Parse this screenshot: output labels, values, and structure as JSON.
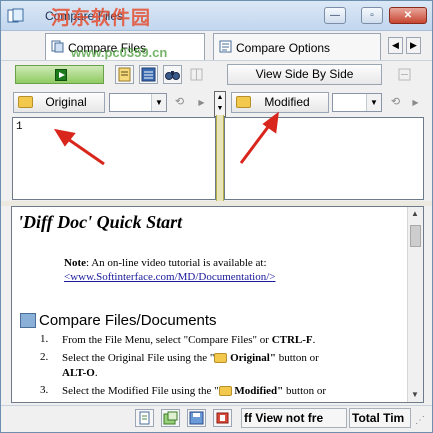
{
  "window": {
    "title": "Compare Files",
    "watermark": "河东软件园",
    "watermark_url": "www.pc0359.cn",
    "controls": {
      "minimize": "—",
      "maximize": "▫",
      "close": "✕"
    }
  },
  "tabs": [
    {
      "label": "Compare Files",
      "active": true
    },
    {
      "label": "Compare Options",
      "active": false
    }
  ],
  "tab_scroll": {
    "left": "◀",
    "right": "▶"
  },
  "toolbar": {
    "view_side_by_side": "View Side By Side"
  },
  "files": {
    "original_button": "Original",
    "modified_button": "Modified",
    "original_combo_value": "",
    "modified_combo_value": ""
  },
  "panes": {
    "left_text": "1",
    "right_text": ""
  },
  "doc": {
    "title": "'Diff Doc' Quick Start",
    "note_label": "Note",
    "note_text": ": An on-line video tutorial is available at:",
    "link": "<www.Softinterface.com/MD/Documentation/>",
    "section_heading": "Compare Files/Documents",
    "steps": [
      {
        "num": "1.",
        "text": "From the File Menu, select \"Compare Files\" or CTRL-F."
      },
      {
        "num": "2.",
        "text": "Select the Original File using the \" Original\" button or ALT-O."
      },
      {
        "num": "3.",
        "text": "Select the Modified File using the \" Modified\" button or"
      }
    ],
    "step_pieces": {
      "s1_pre": "From the File Menu, select \"Compare Files\" or ",
      "s1_bold": "CTRL-F",
      "s1_post": ".",
      "s2_pre": "Select the Original File using the \"",
      "s2_bold": "Original\"",
      "s2_post": " button or",
      "s2_line2": "ALT-O",
      "s2_line2_post": ".",
      "s3_pre": "Select the Modified File using the \"",
      "s3_bold": "Modified\"",
      "s3_post": " button or"
    }
  },
  "status": {
    "cell1": "ff View not fre",
    "cell2": "Total Tim"
  },
  "colors": {
    "accent_green": "#8fcc62",
    "arrow_red": "#d9261c",
    "splitter_yellow": "#e8e6b8"
  }
}
